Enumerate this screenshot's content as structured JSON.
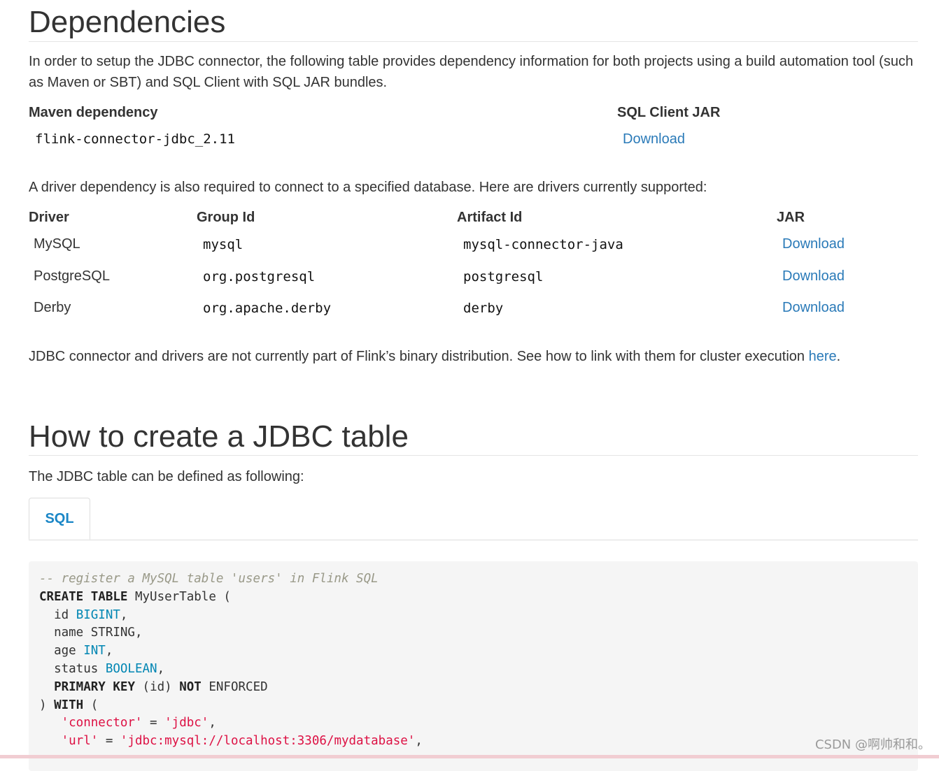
{
  "dependencies": {
    "title": "Dependencies",
    "intro": "In order to setup the JDBC connector, the following table provides dependency information for both projects using a build automation tool (such as Maven or SBT) and SQL Client with SQL JAR bundles.",
    "maven_header": "Maven dependency",
    "jar_header": "SQL Client JAR",
    "maven_value": "flink-connector-jdbc_2.11",
    "jar_link": "Download",
    "driver_intro": "A driver dependency is also required to connect to a specified database. Here are drivers currently supported:",
    "driver_table": {
      "headers": [
        "Driver",
        "Group Id",
        "Artifact Id",
        "JAR"
      ],
      "rows": [
        {
          "driver": "MySQL",
          "group": "mysql",
          "artifact": "mysql-connector-java",
          "jar": "Download"
        },
        {
          "driver": "PostgreSQL",
          "group": "org.postgresql",
          "artifact": "postgresql",
          "jar": "Download"
        },
        {
          "driver": "Derby",
          "group": "org.apache.derby",
          "artifact": "derby",
          "jar": "Download"
        }
      ]
    },
    "note_text": "JDBC connector and drivers are not currently part of Flink’s binary distribution. See how to link with them for cluster execution ",
    "note_link": "here",
    "note_end": "."
  },
  "create_table": {
    "title": "How to create a JDBC table",
    "intro": "The JDBC table can be defined as following:",
    "tab_label": "SQL",
    "code_lines": [
      [
        {
          "t": "-- register a MySQL table 'users' in Flink SQL",
          "c": "comment"
        }
      ],
      [
        {
          "t": "CREATE",
          "c": "kw"
        },
        {
          "t": " ",
          "c": "plain"
        },
        {
          "t": "TABLE",
          "c": "kw"
        },
        {
          "t": " MyUserTable (",
          "c": "plain"
        }
      ],
      [
        {
          "t": "  id ",
          "c": "plain"
        },
        {
          "t": "BIGINT",
          "c": "type"
        },
        {
          "t": ",",
          "c": "plain"
        }
      ],
      [
        {
          "t": "  name STRING,",
          "c": "plain"
        }
      ],
      [
        {
          "t": "  age ",
          "c": "plain"
        },
        {
          "t": "INT",
          "c": "type"
        },
        {
          "t": ",",
          "c": "plain"
        }
      ],
      [
        {
          "t": "  status ",
          "c": "plain"
        },
        {
          "t": "BOOLEAN",
          "c": "type"
        },
        {
          "t": ",",
          "c": "plain"
        }
      ],
      [
        {
          "t": "  ",
          "c": "plain"
        },
        {
          "t": "PRIMARY",
          "c": "kw"
        },
        {
          "t": " ",
          "c": "plain"
        },
        {
          "t": "KEY",
          "c": "kw"
        },
        {
          "t": " (id) ",
          "c": "plain"
        },
        {
          "t": "NOT",
          "c": "kw"
        },
        {
          "t": " ENFORCED",
          "c": "plain"
        }
      ],
      [
        {
          "t": ") ",
          "c": "plain"
        },
        {
          "t": "WITH",
          "c": "kw"
        },
        {
          "t": " (",
          "c": "plain"
        }
      ],
      [
        {
          "t": "   ",
          "c": "plain"
        },
        {
          "t": "'connector'",
          "c": "str"
        },
        {
          "t": " = ",
          "c": "plain"
        },
        {
          "t": "'jdbc'",
          "c": "str"
        },
        {
          "t": ",",
          "c": "plain"
        }
      ],
      [
        {
          "t": "   ",
          "c": "plain"
        },
        {
          "t": "'url'",
          "c": "str"
        },
        {
          "t": " = ",
          "c": "plain"
        },
        {
          "t": "'jdbc:mysql://localhost:3306/mydatabase'",
          "c": "str"
        },
        {
          "t": ",",
          "c": "plain"
        }
      ]
    ]
  },
  "watermark": "CSDN @啊帅和和。",
  "colors": {
    "link": "#2a7ab8",
    "tab_active": "#1a86c6",
    "code_bg": "#f5f5f5",
    "string": "#d14",
    "type": "#0086b3",
    "comment": "#999988"
  }
}
